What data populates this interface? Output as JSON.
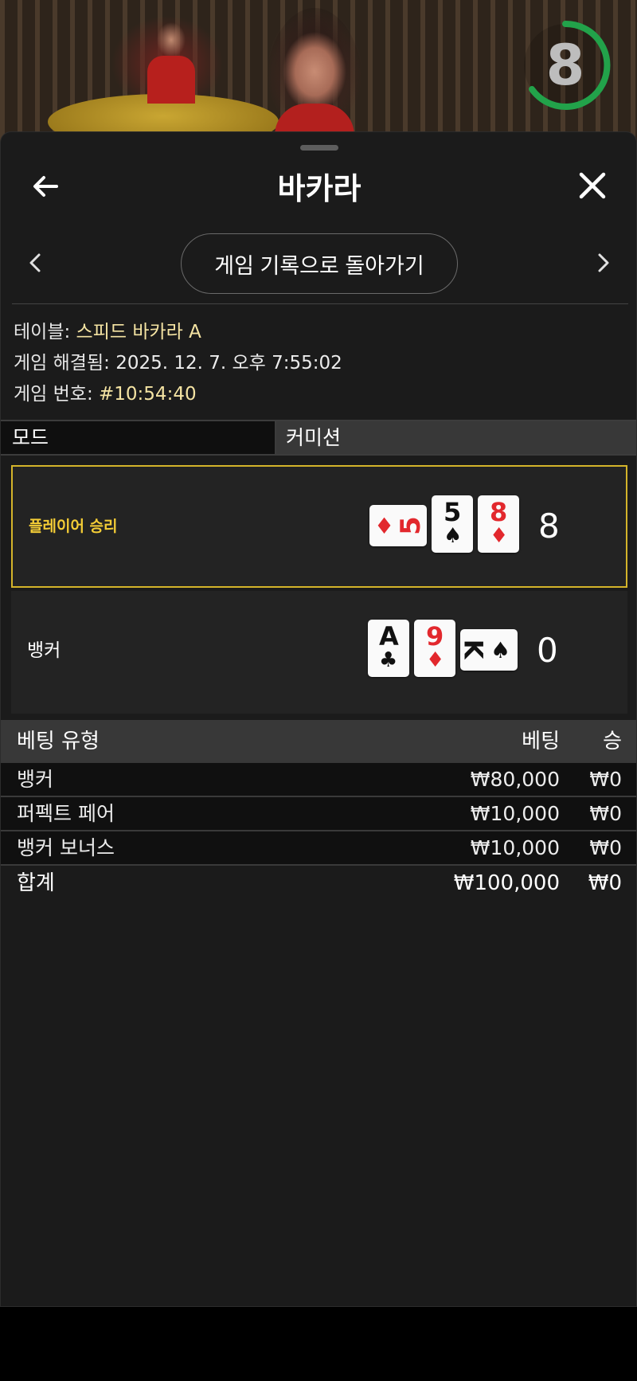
{
  "video": {
    "timer": "8",
    "timer_color": "#22a24a"
  },
  "header": {
    "title": "바카라"
  },
  "nav": {
    "history_button": "게임 기록으로 돌아가기"
  },
  "info": {
    "table_label": "테이블:",
    "table_value": "스피드 바카라 A",
    "resolved_label": "게임 해결됨:",
    "resolved_value": "2025. 12. 7. 오후 7:55:02",
    "number_label": "게임 번호:",
    "number_value": "#10:54:40"
  },
  "mode": {
    "left": "모드",
    "right": "커미션"
  },
  "results": {
    "player": {
      "label": "플레이어 승리",
      "score": "8",
      "cards": [
        {
          "rank": "5",
          "suit": "♦",
          "color": "red",
          "orientation": "horizontal"
        },
        {
          "rank": "5",
          "suit": "♠",
          "color": "black",
          "orientation": "vertical"
        },
        {
          "rank": "8",
          "suit": "♦",
          "color": "red",
          "orientation": "vertical"
        }
      ]
    },
    "banker": {
      "label": "뱅커",
      "score": "0",
      "cards": [
        {
          "rank": "A",
          "suit": "♣",
          "color": "black",
          "orientation": "vertical"
        },
        {
          "rank": "9",
          "suit": "♦",
          "color": "red",
          "orientation": "vertical"
        },
        {
          "rank": "K",
          "suit": "♠",
          "color": "black",
          "orientation": "horizontal"
        }
      ]
    }
  },
  "bets": {
    "headers": {
      "type": "베팅 유형",
      "bet": "베팅",
      "win": "승"
    },
    "rows": [
      {
        "type": "뱅커",
        "bet": "₩80,000",
        "win": "₩0"
      },
      {
        "type": "퍼펙트 페어",
        "bet": "₩10,000",
        "win": "₩0"
      },
      {
        "type": "뱅커 보너스",
        "bet": "₩10,000",
        "win": "₩0"
      }
    ],
    "total": {
      "type": "합계",
      "bet": "₩100,000",
      "win": "₩0"
    }
  },
  "colors": {
    "highlight": "#d4b42a",
    "win_label": "#f4cd36",
    "info_value": "#f5e4a3",
    "card_red": "#e2282d"
  }
}
